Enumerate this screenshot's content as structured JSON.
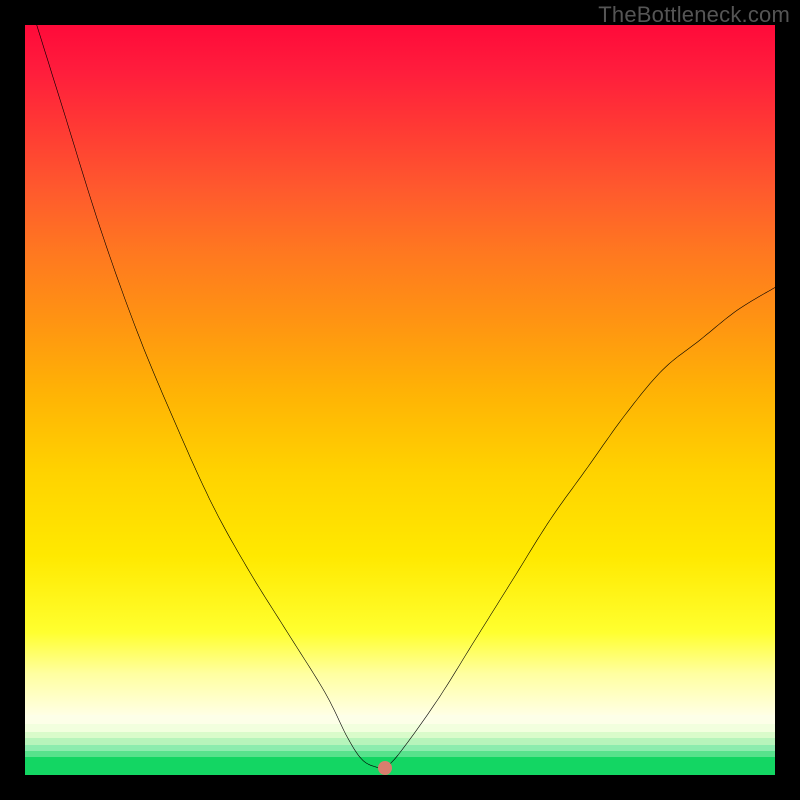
{
  "watermark": "TheBottleneck.com",
  "chart_data": {
    "type": "line",
    "title": "",
    "xlabel": "",
    "ylabel": "",
    "xlim": [
      0,
      100
    ],
    "ylim": [
      0,
      100
    ],
    "series": [
      {
        "name": "bottleneck-curve",
        "x": [
          0,
          5,
          10,
          15,
          20,
          25,
          30,
          35,
          40,
          43,
          45,
          47,
          48,
          50,
          55,
          60,
          65,
          70,
          75,
          80,
          85,
          90,
          95,
          100
        ],
        "values": [
          105,
          89,
          73,
          59,
          47,
          36,
          27,
          19,
          11,
          5,
          2,
          1,
          1,
          3,
          10,
          18,
          26,
          34,
          41,
          48,
          54,
          58,
          62,
          65
        ]
      }
    ],
    "marker": {
      "x": 48,
      "y": 1
    },
    "background_gradient": {
      "orientation": "vertical",
      "stops": [
        {
          "pct": 0,
          "color": "#ff0a3a"
        },
        {
          "pct": 25,
          "color": "#ff6a28"
        },
        {
          "pct": 50,
          "color": "#ffb900"
        },
        {
          "pct": 75,
          "color": "#ffef00"
        },
        {
          "pct": 92,
          "color": "#ffffe0"
        },
        {
          "pct": 97,
          "color": "#b8f7c8"
        },
        {
          "pct": 100,
          "color": "#13d663"
        }
      ]
    }
  }
}
